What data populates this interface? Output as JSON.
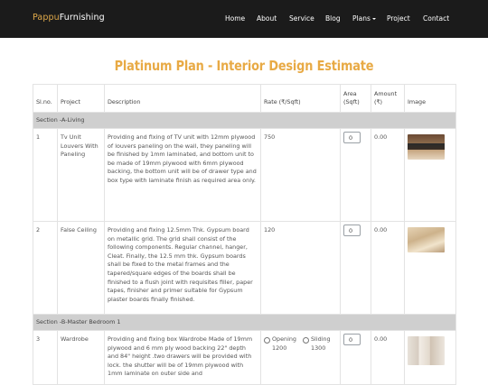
{
  "brand": {
    "part1": "Pappu",
    "part2": "Furnishing"
  },
  "nav": [
    "Home",
    "About",
    "Service",
    "Blog",
    "Plans",
    "Project",
    "Contact"
  ],
  "page_title": "Platinum Plan - Interior Design Estimate",
  "table": {
    "headers": {
      "slno": "Sl.no.",
      "project": "Project",
      "description": "Description",
      "rate": "Rate (₹/Sqft)",
      "area_l1": "Area",
      "area_l2": "(Sqft)",
      "amount_l1": "Amount",
      "amount_l2": "(₹)",
      "image": "Image"
    },
    "sections": [
      "Section -A-Living",
      "Section -B-Master Bedroom 1"
    ],
    "rows": [
      {
        "slno": "1",
        "project": "Tv Unit Louvers With Paneling",
        "description": "Providing and fixing of TV unit with 12mm plywood of louvers paneling on the wall, they paneling will be finished by 1mm laminated, and bottom unit to be made of 19mm plywood with 6mm plywood backing, the bottom unit will be of drawer type and box type with laminate finish as required area only.",
        "rate": "750",
        "area": "0",
        "amount": "0.00"
      },
      {
        "slno": "2",
        "project": "False Ceiling",
        "description": "Providing and fixing 12.5mm Thk. Gypsum board on metallic grid. The grid shall consist of the following components. Regular channel, hanger, Cleat. Finally, the 12.5 mm thk. Gypsum boards shall be fixed to the metal frames and the tapered/square edges of the boards shall be finished to a flush joint with requisites filler, paper tapes, finisher and primer suitable for Gypsum plaster boards finally finished.",
        "rate": "120",
        "area": "0",
        "amount": "0.00"
      },
      {
        "slno": "3",
        "project": "Wardrobe",
        "description": "Providing and fixing box Wardrobe Made of 19mm plywood and 6 mm ply wood backing 22\" depth and 84\" height .two drawers will be provided with lock. the shutter will be of 19mm plywood with 1mm laminate on outer side and",
        "rate_opt1_label": "Opening",
        "rate_opt1_value": "1200",
        "rate_opt2_label": "Sliding",
        "rate_opt2_value": "1300",
        "area": "0",
        "amount": "0.00"
      }
    ]
  }
}
